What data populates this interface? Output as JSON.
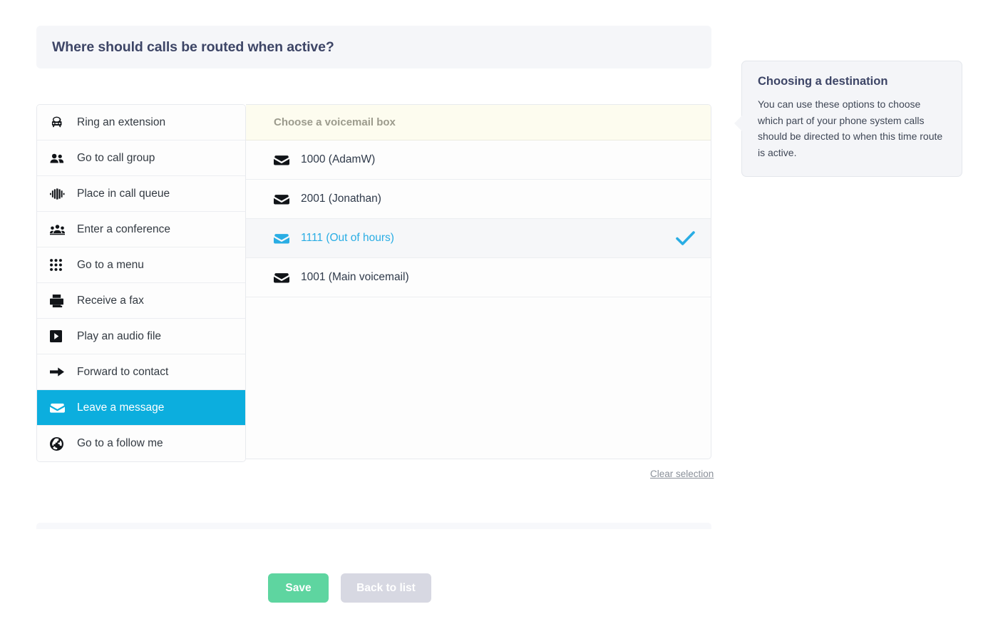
{
  "header": {
    "question": "Where should calls be routed when active?"
  },
  "destinations": {
    "items": [
      {
        "label": "Ring an extension",
        "icon": "telephone-icon",
        "selected": false
      },
      {
        "label": "Go to call group",
        "icon": "users-icon",
        "selected": false
      },
      {
        "label": "Place in call queue",
        "icon": "queue-bars-icon",
        "selected": false
      },
      {
        "label": "Enter a conference",
        "icon": "conference-icon",
        "selected": false
      },
      {
        "label": "Go to a menu",
        "icon": "keypad-grid-icon",
        "selected": false
      },
      {
        "label": "Receive a fax",
        "icon": "fax-icon",
        "selected": false
      },
      {
        "label": "Play an audio file",
        "icon": "play-icon",
        "selected": false
      },
      {
        "label": "Forward to contact",
        "icon": "arrow-right-icon",
        "selected": false
      },
      {
        "label": "Leave a message",
        "icon": "envelope-icon",
        "selected": true
      },
      {
        "label": "Go to a follow me",
        "icon": "globe-icon",
        "selected": false
      }
    ]
  },
  "options": {
    "heading": "Choose a voicemail box",
    "rows": [
      {
        "label": "1000 (AdamW)",
        "icon": "voicemail-envelope-icon",
        "selected": false
      },
      {
        "label": "2001 (Jonathan)",
        "icon": "voicemail-envelope-icon",
        "selected": false
      },
      {
        "label": "1111 (Out of hours)",
        "icon": "voicemail-envelope-icon",
        "selected": true
      },
      {
        "label": "1001 (Main voicemail)",
        "icon": "voicemail-envelope-icon",
        "selected": false
      }
    ],
    "clear_label": "Clear selection"
  },
  "callout": {
    "title": "Choosing a destination",
    "body": "You can use these options to choose which part of your phone system calls should be directed to when this time route is active."
  },
  "footer": {
    "save_label": "Save",
    "back_label": "Back to list"
  },
  "colors": {
    "accent_cyan": "#0caede",
    "selected_text_cyan": "#29ade4",
    "save_green": "#5ed5a0",
    "back_grey": "#d7d8e2",
    "heading_navy": "#3d4566",
    "options_head_cream": "#fdfcef"
  }
}
